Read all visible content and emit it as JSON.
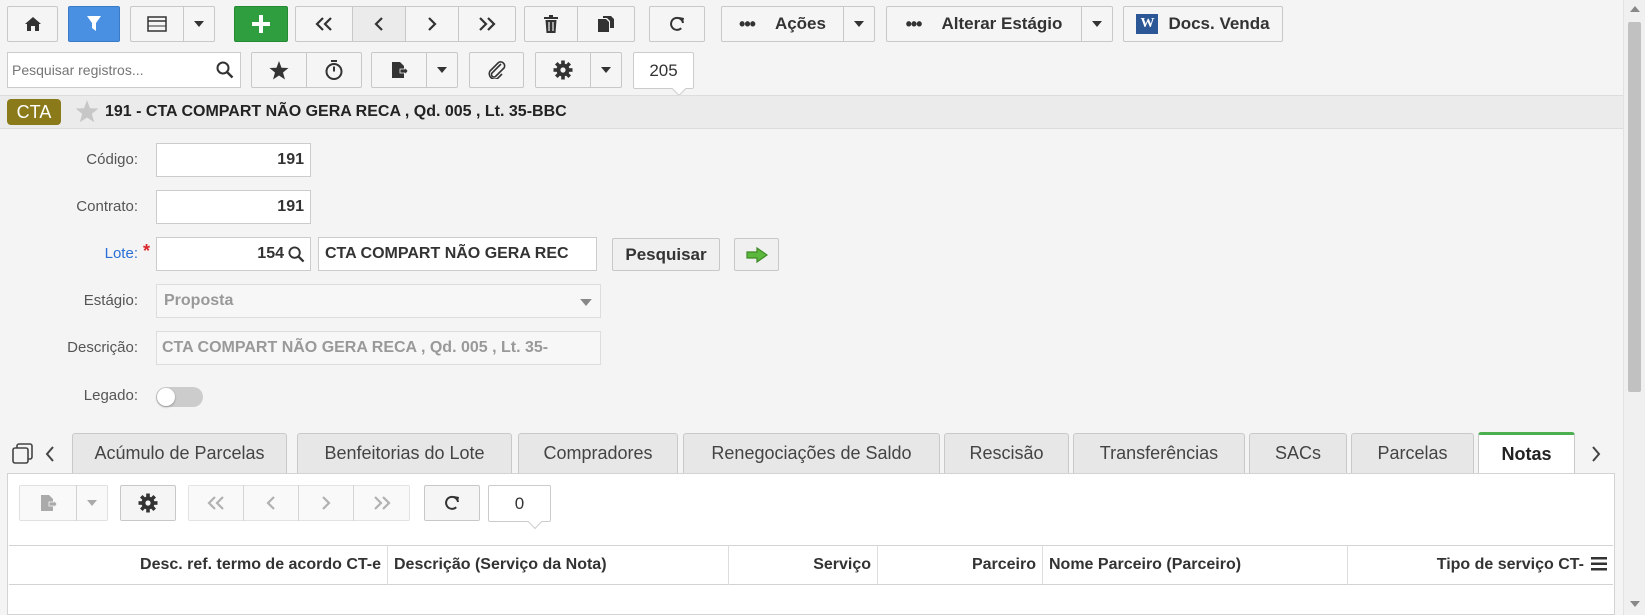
{
  "toolbar": {
    "acoes_label": "Ações",
    "alterar_label": "Alterar Estágio",
    "docs_label": "Docs. Venda",
    "record_count": "205"
  },
  "search": {
    "placeholder": "Pesquisar registros..."
  },
  "header": {
    "badge": "CTA",
    "title": "191 - CTA COMPART NÃO GERA RECA , Qd. 005 , Lt. 35-BBC"
  },
  "form": {
    "codigo_label": "Código:",
    "codigo_value": "191",
    "contrato_label": "Contrato:",
    "contrato_value": "191",
    "lote_label": "Lote:",
    "lote_required": "*",
    "lote_value": "154",
    "lote_desc": "CTA COMPART NÃO GERA REC",
    "pesquisar_label": "Pesquisar",
    "estagio_label": "Estágio:",
    "estagio_value": "Proposta",
    "descricao_label": "Descrição:",
    "descricao_value": "CTA COMPART NÃO GERA RECA ,  Qd. 005 ,  Lt. 35-",
    "legado_label": "Legado:"
  },
  "tabs": [
    "Acúmulo de Parcelas",
    "Benfeitorias do Lote",
    "Compradores",
    "Renegociações de Saldo",
    "Rescisão",
    "Transferências",
    "SACs",
    "Parcelas",
    "Notas"
  ],
  "subgrid": {
    "record_count": "0",
    "columns": [
      "Desc. ref. termo de acordo CT-e",
      "Descrição (Serviço da Nota)",
      "Serviço",
      "Parceiro",
      "Nome Parceiro (Parceiro)",
      "Tipo de serviço CT-"
    ]
  },
  "colors": {
    "accent_blue": "#4a90e2",
    "green": "#2e9e3e",
    "badge": "#8a7a1a",
    "tab_active": "#4caf50"
  },
  "icons": [
    "home-icon",
    "filter-icon",
    "grid-icon",
    "plus-icon",
    "first-icon",
    "prev-icon",
    "next-icon",
    "last-icon",
    "trash-icon",
    "copy-icon",
    "refresh-icon",
    "search-icon",
    "star-icon",
    "timer-icon",
    "report-icon",
    "attach-icon",
    "gear-icon",
    "word-icon",
    "arrow-right-icon",
    "columns-icon"
  ]
}
